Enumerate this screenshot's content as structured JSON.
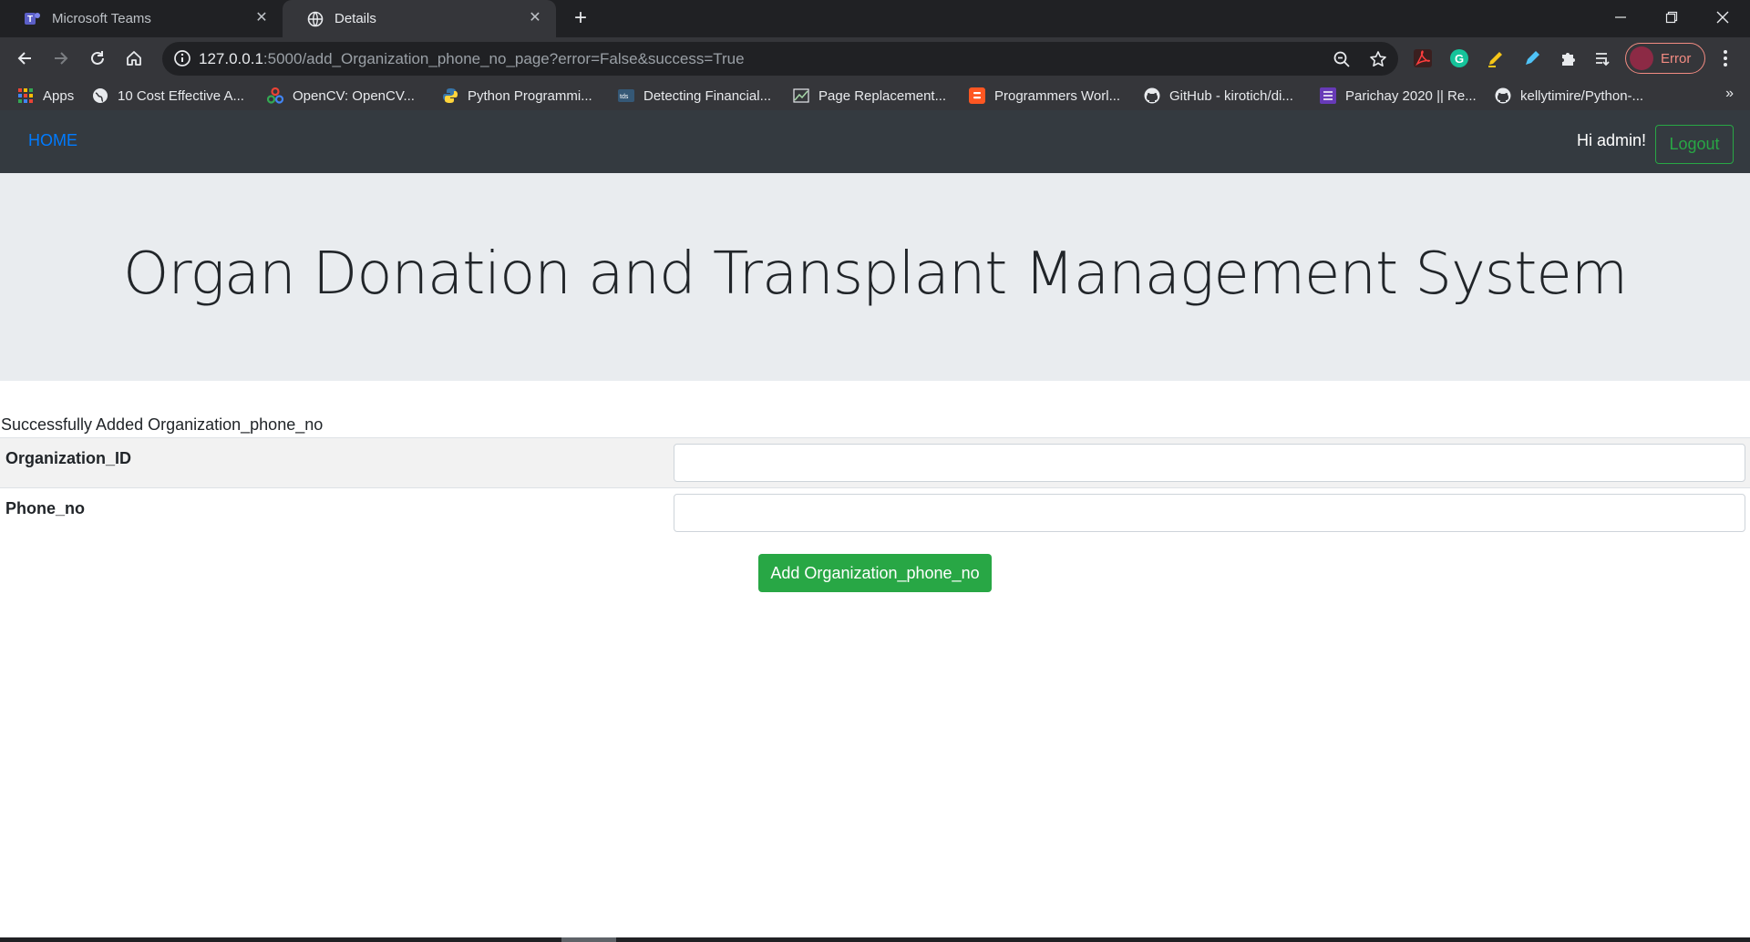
{
  "browser": {
    "tabs": [
      {
        "label": "Microsoft Teams",
        "icon": "teams-icon",
        "active": false
      },
      {
        "label": "Details",
        "icon": "globe-icon",
        "active": true
      }
    ],
    "url_host": "127.0.0.1",
    "url_rest": ":5000/add_Organization_phone_no_page?error=False&success=True",
    "profile_label": "Error",
    "bookmarks": [
      {
        "label": "Apps",
        "icon": "apps-grid-icon"
      },
      {
        "label": "10 Cost Effective A...",
        "icon": "globe-dark-icon"
      },
      {
        "label": "OpenCV: OpenCV...",
        "icon": "opencv-icon"
      },
      {
        "label": "Python Programmi...",
        "icon": "python-icon"
      },
      {
        "label": "Detecting Financial...",
        "icon": "tds-icon"
      },
      {
        "label": "Page Replacement...",
        "icon": "chart-icon"
      },
      {
        "label": "Programmers Worl...",
        "icon": "blogger-icon"
      },
      {
        "label": "GitHub - kirotich/di...",
        "icon": "github-icon"
      },
      {
        "label": "Parichay 2020 || Re...",
        "icon": "list-icon"
      },
      {
        "label": "kellytimire/Python-...",
        "icon": "github-icon"
      }
    ],
    "colors": {
      "chrome_dark": "#202124",
      "chrome_toolbar": "#35363a",
      "profile_error": "#f28b82"
    }
  },
  "navbar": {
    "home_label": "HOME",
    "greeting": "Hi admin!",
    "logout_label": "Logout"
  },
  "jumbotron": {
    "title": "Organ Donation and Transplant Management System"
  },
  "form": {
    "message": "Successfully Added Organization_phone_no",
    "fields": [
      {
        "label": "Organization_ID",
        "value": ""
      },
      {
        "label": "Phone_no",
        "value": ""
      }
    ],
    "submit_label": "Add Organization_phone_no"
  },
  "colors": {
    "primary_link": "#007bff",
    "success": "#28a745",
    "navbar_bg": "#343a40",
    "jumbotron_bg": "#e9ecef"
  }
}
